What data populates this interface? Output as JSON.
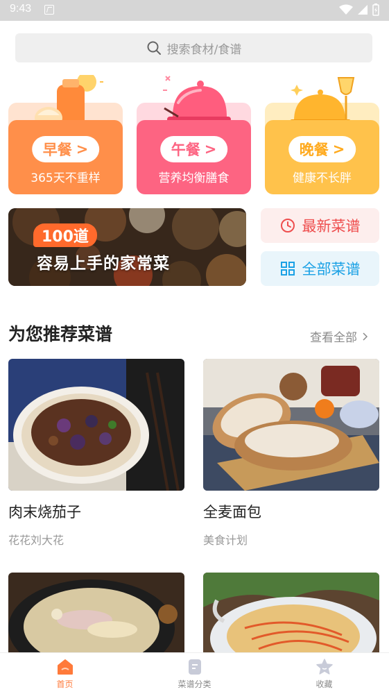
{
  "status": {
    "time": "9:43"
  },
  "search": {
    "placeholder": "搜索食材/食谱"
  },
  "meals": [
    {
      "label": "早餐",
      "sub": "365天不重样",
      "color": "#ff8f4a",
      "light": "#ffd9c0",
      "text_color": "#ff8f4a"
    },
    {
      "label": "午餐",
      "sub": "营养均衡膳食",
      "color": "#fd6482",
      "light": "#ffd1da",
      "text_color": "#fd6482"
    },
    {
      "label": "晚餐",
      "sub": "健康不长胖",
      "color": "#ffc24b",
      "light": "#ffe8b5",
      "text_color": "#ffaa1e"
    }
  ],
  "banner": {
    "count": "100道",
    "title": "容易上手的家常菜"
  },
  "quick": {
    "latest": "最新菜谱",
    "all": "全部菜谱"
  },
  "section": {
    "title": "为您推荐菜谱",
    "view_all": "查看全部"
  },
  "recipes": [
    {
      "name": "肉末烧茄子",
      "author": "花花刘大花"
    },
    {
      "name": "全麦面包",
      "author": "美食计划"
    },
    {
      "name": "",
      "author": ""
    },
    {
      "name": "",
      "author": ""
    }
  ],
  "nav": [
    {
      "label": "首页",
      "icon": "home-icon",
      "active": true
    },
    {
      "label": "菜谱分类",
      "icon": "recipe-book-icon",
      "active": false
    },
    {
      "label": "收藏",
      "icon": "star-icon",
      "active": false
    }
  ],
  "colors": {
    "accent": "#ff7a3a",
    "red": "#ee4d4d",
    "blue": "#1aa1e5"
  }
}
